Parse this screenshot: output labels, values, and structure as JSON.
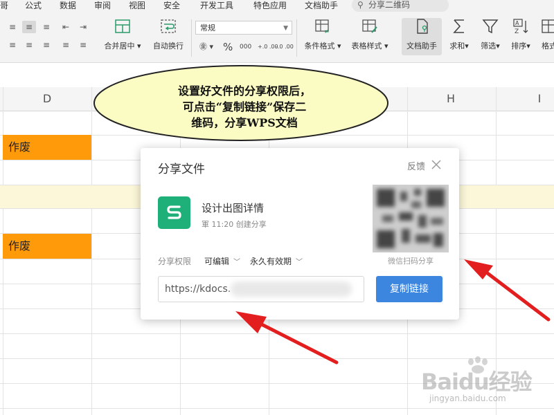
{
  "ribbon": {
    "menu": [
      "哥",
      "公式",
      "数据",
      "审阅",
      "视图",
      "安全",
      "开发工具",
      "特色应用",
      "文档助手"
    ],
    "search_placeholder": "分享二维码",
    "format_select": "常规",
    "buttons": {
      "merge_center": "合并居中",
      "wrap": "自动换行",
      "conditional_format": "条件格式",
      "table_style": "表格样式",
      "doc_assistant": "文档助手",
      "sum": "求和",
      "filter": "筛选",
      "sort": "排序",
      "format": "格式"
    },
    "number_buttons": [
      "%",
      "000",
      "+.0 .00",
      "-.0 .00"
    ]
  },
  "sheet": {
    "columns": [
      "D",
      "H",
      "I"
    ],
    "orange_cells": [
      "作废",
      "作废"
    ]
  },
  "bubble": {
    "lines": [
      "设置好文件的分享权限后，",
      "可点击“复制链接”保存二",
      "维码，分享WPS文档"
    ]
  },
  "dialog": {
    "title": "分享文件",
    "feedback": "反馈",
    "doc_name": "设计出图详情",
    "doc_meta": "軍 11:20 创建分享",
    "qr_caption": "微信扫码分享",
    "permission_label": "分享权限",
    "permission_value": "可编辑",
    "expiry_value": "永久有效期",
    "link_value": "https://kdocs.",
    "copy_button": "复制链接"
  },
  "watermark": {
    "brand": "Baidu经验",
    "site": "jingyan.baidu.com"
  },
  "colors": {
    "orange_cell": "#ff9b0a",
    "highlight_row": "#fcf7d9",
    "bubble_fill": "#fbfbc4",
    "copy_button": "#3d86e0",
    "doc_icon": "#1fb07a",
    "arrow": "#e31e1e"
  }
}
